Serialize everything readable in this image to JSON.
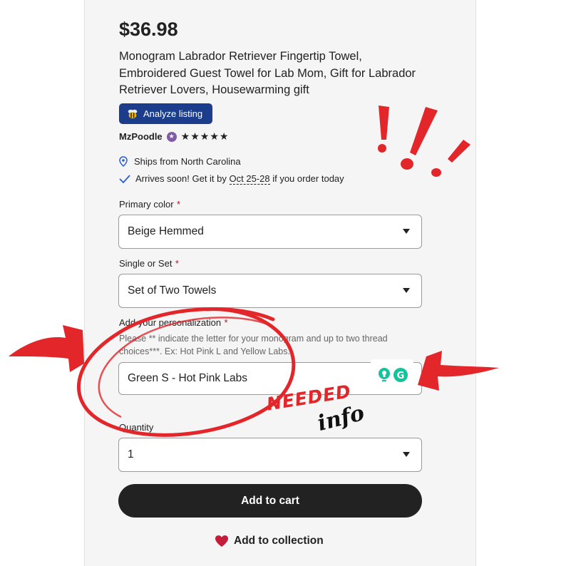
{
  "product": {
    "price": "$36.98",
    "title": "Monogram Labrador Retriever Fingertip Towel, Embroidered Guest Towel for Lab Mom, Gift for Labrador Retriever Lovers, Housewarming gift"
  },
  "analyze_button": {
    "label": "Analyze listing"
  },
  "shop": {
    "name": "MzPoodle",
    "stars": "★★★★★",
    "rating": 5
  },
  "shipping": {
    "ships_from": "Ships from North Carolina",
    "arrives_prefix": "Arrives soon! Get it by ",
    "arrives_dates": "Oct 25-28",
    "arrives_suffix": " if you order today"
  },
  "options": {
    "primary_color": {
      "label": "Primary color",
      "required_mark": "*",
      "selected": "Beige Hemmed"
    },
    "single_or_set": {
      "label": "Single or Set",
      "required_mark": "*",
      "selected": "Set of Two Towels"
    },
    "personalization": {
      "label": "Add your personalization",
      "required_mark": "*",
      "hint": "Please ** indicate the letter for your monogram and up to two thread choices***. Ex: Hot Pink L and Yellow Labs.",
      "value": "Green S - Hot Pink Labs"
    },
    "quantity": {
      "label": "Quantity",
      "selected": "1"
    }
  },
  "actions": {
    "add_to_cart": "Add to cart",
    "add_to_collection": "Add to collection"
  },
  "annotations": {
    "needed": "NEEDED",
    "info": "info"
  },
  "colors": {
    "accent_red": "#e3262a",
    "button_dark": "#222222",
    "analyze_blue": "#1c3d8c",
    "star_seller_purple": "#7f5aa8",
    "grammarly_green": "#15c39a"
  }
}
